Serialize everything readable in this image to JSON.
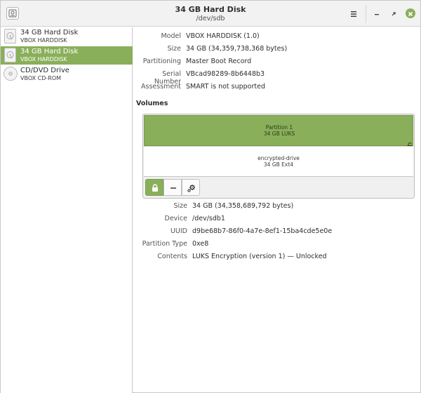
{
  "window": {
    "title": "34 GB Hard Disk",
    "subtitle": "/dev/sdb"
  },
  "colors": {
    "accent": "#8aaf5a",
    "accent_border": "#76994a"
  },
  "header_icons": {
    "app": "disk-app-icon",
    "menu": "hamburger-menu-icon",
    "minimize": "minimize-icon",
    "maximize": "maximize-icon",
    "close": "close-icon"
  },
  "sidebar": {
    "drives": [
      {
        "name": "34 GB Hard Disk",
        "sub": "VBOX HARDDISK",
        "icon": "hard-disk-icon",
        "selected": false
      },
      {
        "name": "34 GB Hard Disk",
        "sub": "VBOX HARDDISK",
        "icon": "hard-disk-icon",
        "selected": true
      },
      {
        "name": "CD/DVD Drive",
        "sub": "VBOX CD-ROM",
        "icon": "optical-drive-icon",
        "selected": false
      }
    ]
  },
  "drive_info": {
    "model_label": "Model",
    "model": "VBOX HARDDISK (1.0)",
    "size_label": "Size",
    "size": "34 GB (34,359,738,368 bytes)",
    "partitioning_label": "Partitioning",
    "partitioning": "Master Boot Record",
    "serial_label": "Serial Number",
    "serial": "VBcad98289-8b6448b3",
    "assessment_label": "Assessment",
    "assessment": "SMART is not supported"
  },
  "volumes": {
    "title": "Volumes",
    "partition": {
      "name": "Partition 1",
      "desc": "34 GB LUKS"
    },
    "inner": {
      "name": "encrypted-drive",
      "desc": "34 GB Ext4"
    },
    "toolbar": {
      "lock_icon": "lock-icon",
      "minus_icon": "minus-icon",
      "gear_icon": "gears-icon"
    }
  },
  "volume_info": {
    "size_label": "Size",
    "size": "34 GB (34,358,689,792 bytes)",
    "device_label": "Device",
    "device": "/dev/sdb1",
    "uuid_label": "UUID",
    "uuid": "d9be68b7-86f0-4a7e-8ef1-15ba4cde5e0e",
    "ptype_label": "Partition Type",
    "ptype": "0xe8",
    "contents_label": "Contents",
    "contents": "LUKS Encryption (version 1) — Unlocked"
  }
}
